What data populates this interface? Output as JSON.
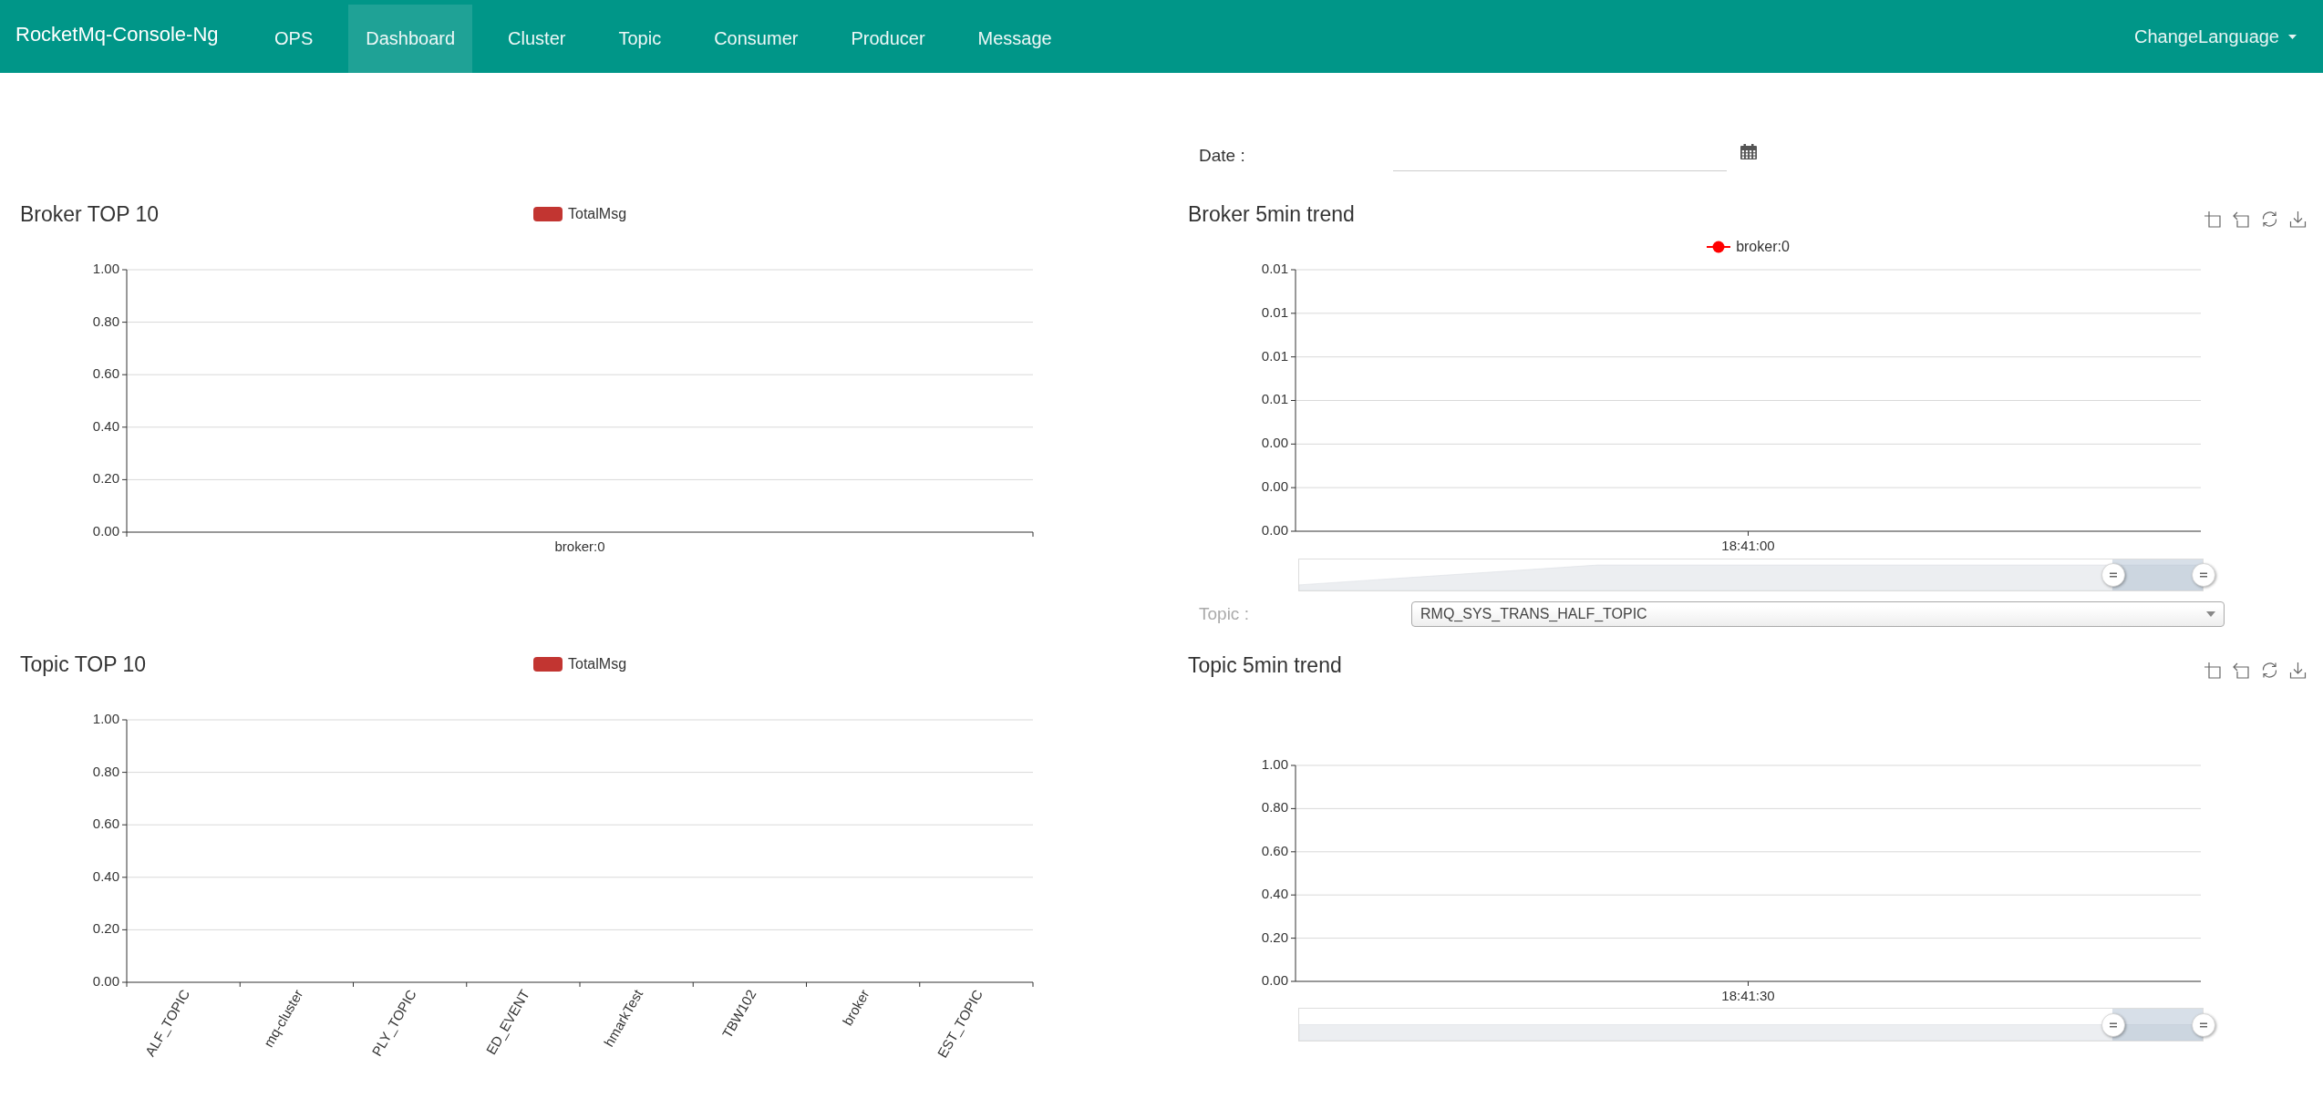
{
  "navbar": {
    "brand": "RocketMq-Console-Ng",
    "items": [
      {
        "label": "OPS",
        "selected": false
      },
      {
        "label": "Dashboard",
        "selected": true
      },
      {
        "label": "Cluster",
        "selected": false
      },
      {
        "label": "Topic",
        "selected": false
      },
      {
        "label": "Consumer",
        "selected": false
      },
      {
        "label": "Producer",
        "selected": false
      },
      {
        "label": "Message",
        "selected": false
      }
    ],
    "language_menu": {
      "label": "ChangeLanguage"
    }
  },
  "date_filter": {
    "label": "Date :"
  },
  "broker_top": {
    "title": "Broker TOP 10",
    "chart_data": {
      "type": "bar",
      "categories": [
        "broker:0"
      ],
      "series": [
        {
          "name": "TotalMsg",
          "color": "#c23531",
          "values": [
            null
          ]
        }
      ],
      "ylim": [
        0,
        1
      ],
      "grid": true,
      "yticks": [
        {
          "value": 0,
          "label": "0.00"
        },
        {
          "value": 0.2,
          "label": "0.20"
        },
        {
          "value": 0.4,
          "label": "0.40"
        },
        {
          "value": 0.6,
          "label": "0.60"
        },
        {
          "value": 0.8,
          "label": "0.80"
        },
        {
          "value": 1,
          "label": "1.00"
        }
      ]
    }
  },
  "broker_trend": {
    "title": "Broker 5min trend",
    "chart_data": {
      "type": "line",
      "categories": [
        "18:41:00"
      ],
      "series": [
        {
          "name": "broker:0",
          "color": "#ff0000",
          "values": [
            null
          ]
        }
      ],
      "ylim": [
        0,
        0.012
      ],
      "grid": true,
      "yticks": [
        {
          "value": 0,
          "label": "0.00"
        },
        {
          "value": 0.002,
          "label": "0.00"
        },
        {
          "value": 0.004,
          "label": "0.00"
        },
        {
          "value": 0.006,
          "label": "0.01"
        },
        {
          "value": 0.008,
          "label": "0.01"
        },
        {
          "value": 0.01,
          "label": "0.01"
        },
        {
          "value": 0.012,
          "label": "0.01"
        }
      ]
    },
    "data_zoom": {
      "handles": [
        {
          "level": 0.9
        },
        {
          "level": 1
        }
      ]
    }
  },
  "topic_filter": {
    "label": "Topic :",
    "value": "RMQ_SYS_TRANS_HALF_TOPIC"
  },
  "topic_top": {
    "title": "Topic TOP 10",
    "chart_data": {
      "type": "bar",
      "categories": [
        "ALF_TOPIC",
        "mq-cluster",
        "PLY_TOPIC",
        "ED_EVENT",
        "hmarkTest",
        "TBW102",
        "broker",
        "EST_TOPIC"
      ],
      "series": [
        {
          "name": "TotalMsg",
          "color": "#c23531",
          "values": [
            null,
            null,
            null,
            null,
            null,
            null,
            null,
            null
          ]
        }
      ],
      "ylim": [
        0,
        1
      ],
      "grid": true,
      "yticks": [
        {
          "value": 0,
          "label": "0.00"
        },
        {
          "value": 0.2,
          "label": "0.20"
        },
        {
          "value": 0.4,
          "label": "0.40"
        },
        {
          "value": 0.6,
          "label": "0.60"
        },
        {
          "value": 0.8,
          "label": "0.80"
        },
        {
          "value": 1,
          "label": "1.00"
        }
      ]
    }
  },
  "topic_trend": {
    "title": "Topic 5min trend",
    "chart_data": {
      "type": "line",
      "categories": [
        "18:41:30"
      ],
      "ylim": [
        0,
        1
      ],
      "grid": true,
      "yticks": [
        {
          "value": 0,
          "label": "0.00"
        },
        {
          "value": 0.2,
          "label": "0.20"
        },
        {
          "value": 0.4,
          "label": "0.40"
        },
        {
          "value": 0.6,
          "label": "0.60"
        },
        {
          "value": 0.8,
          "label": "0.80"
        },
        {
          "value": 1,
          "label": "1.00"
        }
      ]
    },
    "data_zoom": {
      "handles": [
        {
          "level": 0.9
        },
        {
          "level": 1
        }
      ]
    }
  }
}
